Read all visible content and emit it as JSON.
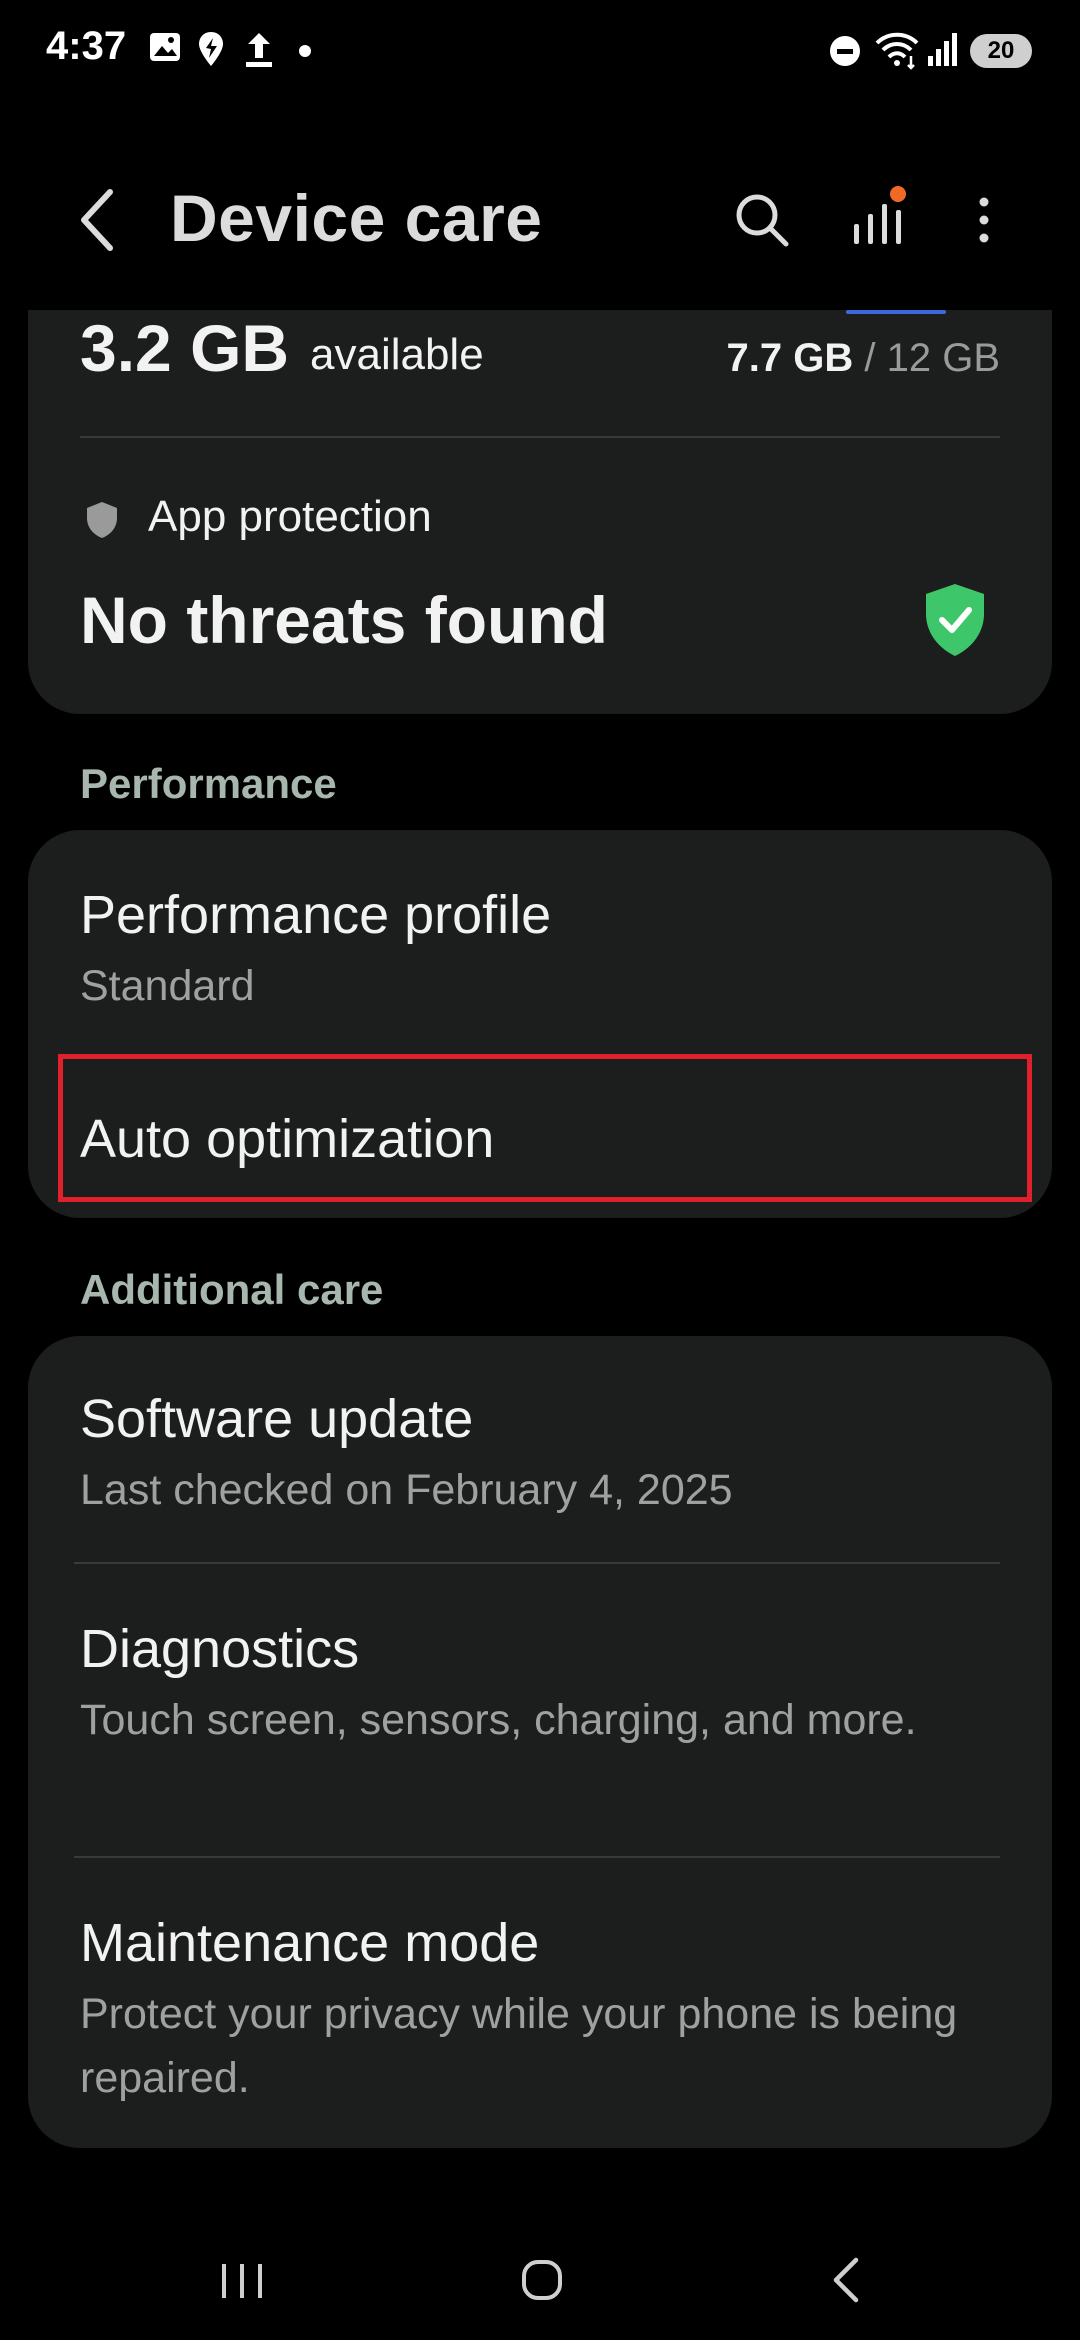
{
  "status_bar": {
    "time": "4:37",
    "battery": "20",
    "icons": [
      "gallery-icon",
      "location-icon",
      "upload-icon",
      "dot-icon",
      "dnd-icon",
      "wifi-icon",
      "signal-icon",
      "battery-icon"
    ]
  },
  "app_bar": {
    "title": "Device care",
    "icons": [
      "back-icon",
      "search-icon",
      "stats-icon",
      "more-options-icon"
    ],
    "notification_dot_color": "#f06a24"
  },
  "memory": {
    "available_value": "3.2 GB",
    "available_label": "available",
    "used": "7.7 GB",
    "separator": "/",
    "total": "12 GB"
  },
  "app_protection": {
    "label": "App protection",
    "status": "No threats found",
    "status_color": "#3ec76a"
  },
  "performance": {
    "header": "Performance",
    "items": [
      {
        "title": "Performance profile",
        "subtitle": "Standard"
      },
      {
        "title": "Auto optimization"
      }
    ]
  },
  "additional_care": {
    "header": "Additional care",
    "items": [
      {
        "title": "Software update",
        "subtitle": "Last checked on February 4, 2025"
      },
      {
        "title": "Diagnostics",
        "subtitle": "Touch screen, sensors, charging, and more."
      },
      {
        "title": "Maintenance mode",
        "subtitle": "Protect your privacy while your phone is being repaired."
      }
    ]
  },
  "highlight_color": "#e0202a",
  "nav_bar": {
    "icons": [
      "recent-apps-icon",
      "home-icon",
      "back-nav-icon"
    ]
  }
}
